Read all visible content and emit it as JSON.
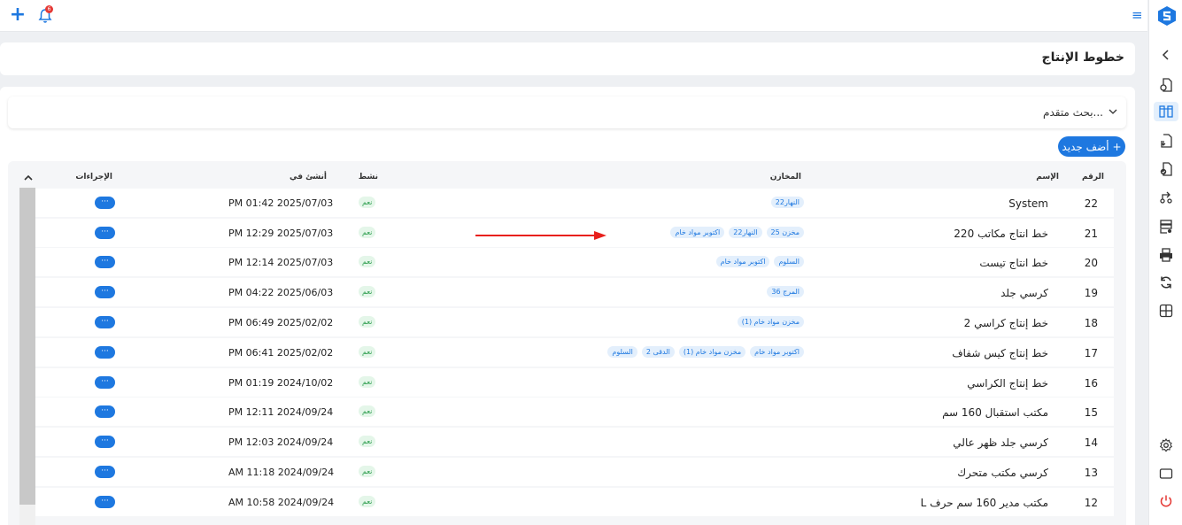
{
  "topbar": {
    "add_icon": "plus-icon",
    "bell_icon": "bell-icon",
    "notification_count": "6",
    "menu_icon": "hamburger-icon"
  },
  "sidebar": {
    "logo_icon": "brand-logo-icon",
    "items": [
      {
        "icon": "chevron-left-icon"
      },
      {
        "icon": "document-search-icon"
      },
      {
        "icon": "production-lines-icon",
        "active": true
      },
      {
        "icon": "document-download-icon"
      },
      {
        "icon": "document-check-icon"
      },
      {
        "icon": "workflow-icon"
      },
      {
        "icon": "database-settings-icon"
      },
      {
        "icon": "printer-icon"
      },
      {
        "icon": "sync-icon"
      },
      {
        "icon": "layout-grid-icon"
      },
      {
        "icon": "gear-icon"
      },
      {
        "icon": "window-icon"
      },
      {
        "icon": "power-icon"
      }
    ]
  },
  "page": {
    "title": "خطوط الإنتاج",
    "advanced_search": "بحث متقدم...",
    "add_new": "أضف جديد"
  },
  "table": {
    "headers": {
      "number": "الرقم",
      "name": "الإسم",
      "stores": "المخازن",
      "active": "نشط",
      "created_at": "أنشئ في",
      "actions": "الإجراءات"
    },
    "rows": [
      {
        "number": "22",
        "name": "System",
        "stores": [
          "النهار22"
        ],
        "active": "نعم",
        "created_at": "PM 01:42 2025/07/03",
        "action": "···"
      },
      {
        "number": "21",
        "name": "خط انتاج مكاتب 220",
        "stores": [
          "مخزن 25",
          "النهار22",
          "اكتوبر مواد خام"
        ],
        "active": "نعم",
        "created_at": "PM 12:29 2025/07/03",
        "action": "···"
      },
      {
        "number": "20",
        "name": "خط انتاج تيست",
        "stores": [
          "السلوم",
          "اكتوبر مواد خام"
        ],
        "active": "نعم",
        "created_at": "PM 12:14 2025/07/03",
        "action": "···"
      },
      {
        "number": "19",
        "name": "كرسي جلد",
        "stores": [
          "المرج 36"
        ],
        "active": "نعم",
        "created_at": "PM 04:22 2025/06/03",
        "action": "···"
      },
      {
        "number": "18",
        "name": "خط إنتاج كراسي 2",
        "stores": [
          "مخزن مواد خام (1)"
        ],
        "active": "نعم",
        "created_at": "PM 06:49 2025/02/02",
        "action": "···"
      },
      {
        "number": "17",
        "name": "خط إنتاج كيس شفاف",
        "stores": [
          "اكتوبر مواد خام",
          "مخزن مواد خام (1)",
          "الدقى 2",
          "السلوم"
        ],
        "active": "نعم",
        "created_at": "PM 06:41 2025/02/02",
        "action": "···"
      },
      {
        "number": "16",
        "name": "خط إنتاج الكراسي",
        "stores": [],
        "active": "نعم",
        "created_at": "PM 01:19 2024/10/02",
        "action": "···"
      },
      {
        "number": "15",
        "name": "مكتب استقبال 160 سم",
        "stores": [],
        "active": "نعم",
        "created_at": "PM 12:11 2024/09/24",
        "action": "···"
      },
      {
        "number": "14",
        "name": "كرسي جلد ظهر عالي",
        "stores": [],
        "active": "نعم",
        "created_at": "PM 12:03 2024/09/24",
        "action": "···"
      },
      {
        "number": "13",
        "name": "كرسي مكتب متحرك",
        "stores": [],
        "active": "نعم",
        "created_at": "AM 11:18 2024/09/24",
        "action": "···"
      },
      {
        "number": "12",
        "name": "مكتب مدير 160 سم حرف L",
        "stores": [],
        "active": "نعم",
        "created_at": "AM 10:58 2024/09/24",
        "action": "···"
      }
    ]
  },
  "colors": {
    "primary": "#1e78e0",
    "annotation_arrow": "#e8201c",
    "active_badge_bg": "#e4f6e9",
    "active_badge_text": "#2e9e4f"
  }
}
